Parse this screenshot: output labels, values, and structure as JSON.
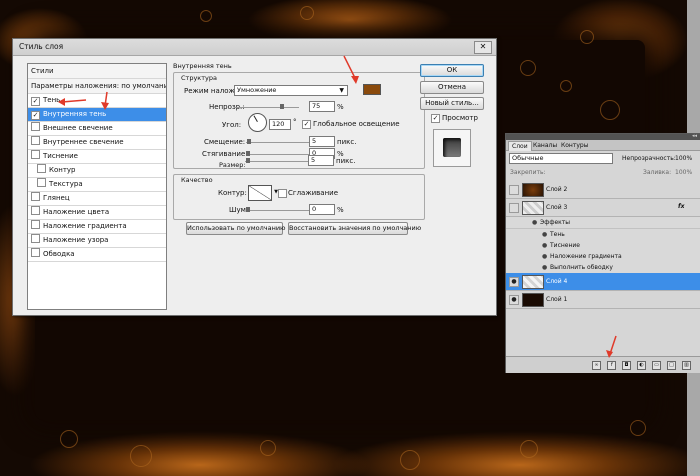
{
  "dialog": {
    "title": "Стиль слоя",
    "close_label": "✕",
    "styles_header": "Стили",
    "blend_default": "Параметры наложения: по умолчанию",
    "items": [
      {
        "label": "Тень",
        "checked": true
      },
      {
        "label": "Внутренняя тень",
        "checked": true
      },
      {
        "label": "Внешнее свечение",
        "checked": false
      },
      {
        "label": "Внутреннее свечение",
        "checked": false
      },
      {
        "label": "Тиснение",
        "checked": false
      },
      {
        "label": "Контур",
        "checked": false
      },
      {
        "label": "Текстура",
        "checked": false
      },
      {
        "label": "Глянец",
        "checked": false
      },
      {
        "label": "Наложение цвета",
        "checked": false
      },
      {
        "label": "Наложение градиента",
        "checked": false
      },
      {
        "label": "Наложение узора",
        "checked": false
      },
      {
        "label": "Обводка",
        "checked": false
      }
    ],
    "section_title": "Внутренняя тень",
    "structure": {
      "title": "Структура",
      "blend_mode_label": "Режим наложения:",
      "blend_mode_value": "Умножение",
      "color": "#8a4a0c",
      "opacity_label": "Непрозр.:",
      "opacity_value": "75",
      "opacity_fraction": 0.75,
      "angle_label": "Угол:",
      "angle_value": "120",
      "degree_symbol": "°",
      "global_light_label": "Глобальное освещение",
      "global_light_checked": true,
      "distance_label": "Смещение:",
      "distance_value": "5",
      "distance_fraction": 0.02,
      "choke_label": "Стягивание:",
      "choke_value": "0",
      "choke_fraction": 0,
      "size_label": "Размер:",
      "size_value": "5",
      "size_fraction": 0.02,
      "unit_px": "пикс.",
      "unit_percent": "%"
    },
    "quality": {
      "title": "Качество",
      "contour_label": "Контур:",
      "antialias_label": "Сглаживание",
      "noise_label": "Шум:",
      "noise_value": "0",
      "noise_fraction": 0,
      "unit_percent": "%"
    },
    "make_default_label": "Использовать по умолчанию",
    "reset_default_label": "Восстановить значения по умолчанию",
    "ok_label": "ОК",
    "cancel_label": "Отмена",
    "new_style_label": "Новый стиль...",
    "preview_label": "Просмотр",
    "preview_checked": true
  },
  "layers_panel": {
    "collapse_label": "◂◂",
    "tabs": [
      "Слои",
      "Каналы",
      "Контуры"
    ],
    "blend_mode": "Обычные",
    "opacity_label": "Непрозрачность:",
    "opacity_value": "100%",
    "lock_label": "Закрепить:",
    "fill_label": "Заливка:",
    "fill_value": "100%",
    "fx_label": "fx",
    "layers": [
      {
        "name": "Слой 2",
        "visible": false,
        "selected": false
      },
      {
        "name": "Слой 3",
        "visible": false,
        "selected": false,
        "has_fx": true
      },
      {
        "name": "Слой 4",
        "visible": true,
        "selected": true
      },
      {
        "name": "Слой 1",
        "visible": true,
        "selected": false
      }
    ],
    "effects_header": "Эффекты",
    "effects": [
      "Тень",
      "Тиснение",
      "Наложение градиента",
      "Выполнить обводку"
    ],
    "accent": "#3d8ee8"
  },
  "annotation_color": "#e03a2a"
}
